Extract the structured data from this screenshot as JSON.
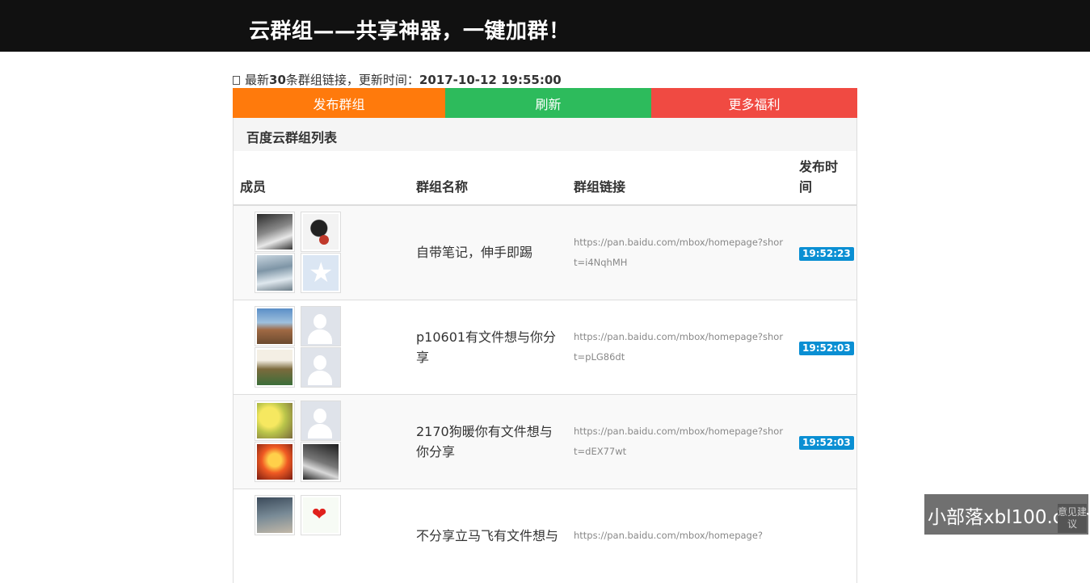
{
  "header": {
    "title": "云群组——共享神器，一键加群！"
  },
  "info": {
    "prefix": "最新",
    "count": "30",
    "middle": "条群组链接，更新时间：",
    "updated": "2017-10-12 19:55:00"
  },
  "actions": {
    "publish": "发布群组",
    "refresh": "刷新",
    "more": "更多福利"
  },
  "panel": {
    "title": "百度云群组列表"
  },
  "table": {
    "headers": {
      "members": "成员",
      "name": "群组名称",
      "link": "群组链接",
      "time": "发布时间"
    },
    "rows": [
      {
        "name": "自带笔记，伸手即踢",
        "link": "https://pan.baidu.com/mbox/homepage?short=i4NqhMH",
        "time": "19:52:23",
        "avatars": [
          "avatar-photo-dark-portrait",
          "avatar-anime-wuliao",
          "avatar-photo-sky",
          "avatar-qzone-star"
        ]
      },
      {
        "name": "p10601有文件想与你分享",
        "link": "https://pan.baidu.com/mbox/homepage?short=pLG86dt",
        "time": "19:52:03",
        "avatars": [
          "avatar-photo-man",
          "avatar-default-person",
          "avatar-photo-poster",
          "avatar-default-person"
        ]
      },
      {
        "name": "2170狗暖你有文件想与你分享",
        "link": "https://pan.baidu.com/mbox/homepage?short=dEX77wt",
        "time": "19:52:03",
        "avatars": [
          "avatar-photo-flowers",
          "avatar-default-person",
          "avatar-photo-fire",
          "avatar-photo-dark-portrait"
        ]
      },
      {
        "name": "不分享立马飞有文件想与",
        "link": "https://pan.baidu.com/mbox/homepage?",
        "time": "",
        "avatars": [
          "avatar-photo-anime-boy",
          "avatar-heart"
        ]
      }
    ]
  },
  "watermark": {
    "text": "小部落xbl100.com",
    "suggest": "意见建议"
  }
}
